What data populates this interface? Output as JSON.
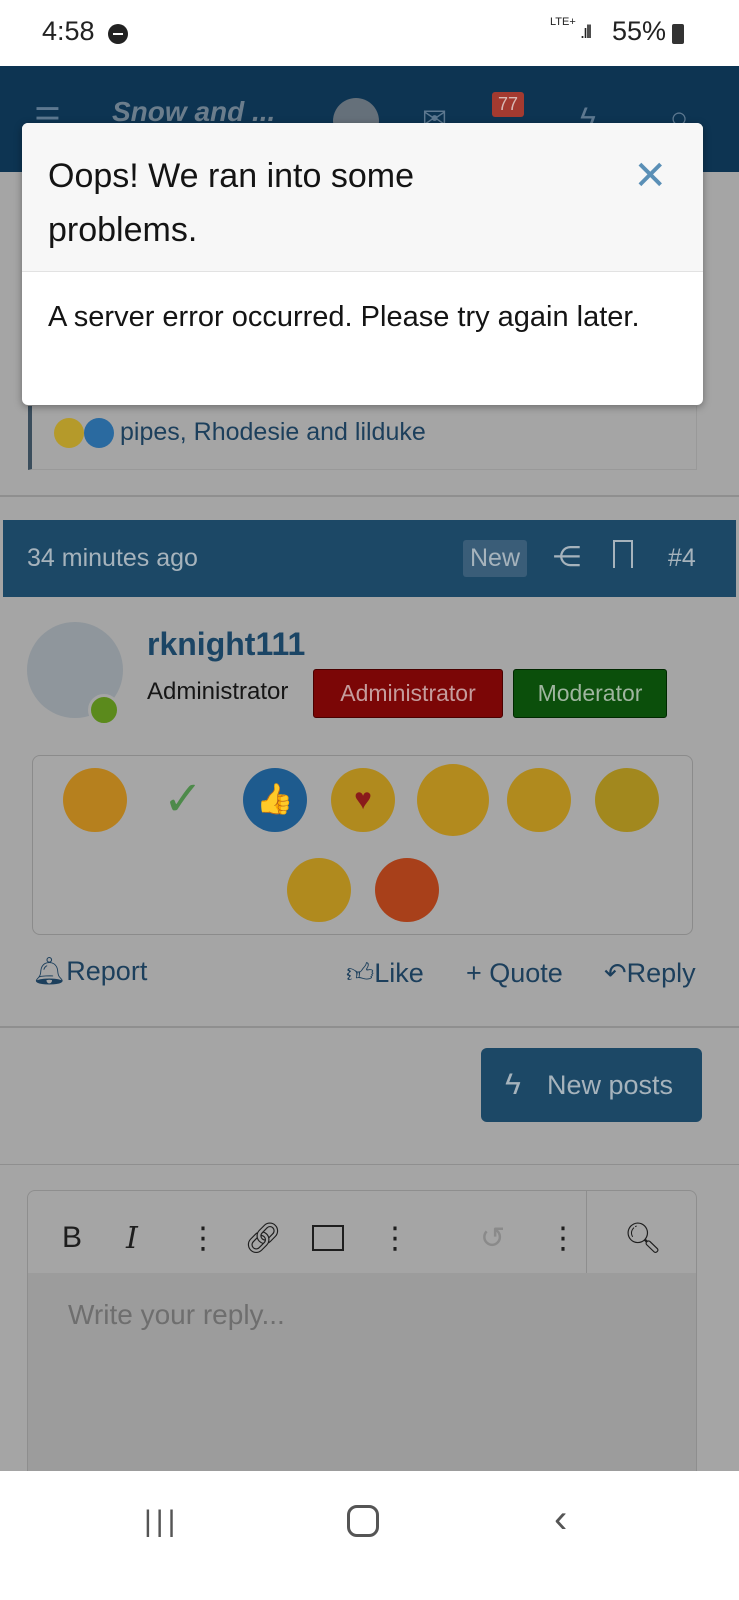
{
  "status_bar": {
    "time": "4:58",
    "network": "LTE+",
    "battery": "55%"
  },
  "header": {
    "logo": "Snow and ...",
    "notification_count": "77"
  },
  "modal": {
    "title": "Oops! We ran into some problems.",
    "message": "A server error occurred. Please try again later.",
    "close_icon": "close-icon"
  },
  "previous_post": {
    "reactions_text": "pipes, Rhodesie and lilduke"
  },
  "post": {
    "time": "34 minutes ago",
    "new_badge": "New",
    "number": "#4",
    "username": "rknight111",
    "user_title": "Administrator",
    "banners": [
      "Administrator",
      "Moderator"
    ],
    "banner_colors": {
      "Administrator": "#7b0606",
      "Moderator": "#0b4f0b"
    }
  },
  "reactions_popup": {
    "items": [
      "laugh",
      "check",
      "like",
      "love",
      "wow",
      "haha",
      "sick",
      "sad",
      "angry"
    ]
  },
  "actions": {
    "report": "Report",
    "like": "Like",
    "quote": "+ Quote",
    "reply": "Reply"
  },
  "new_posts_button": "New posts",
  "editor": {
    "placeholder": "Write your reply...",
    "bold": "B",
    "italic": "I"
  }
}
